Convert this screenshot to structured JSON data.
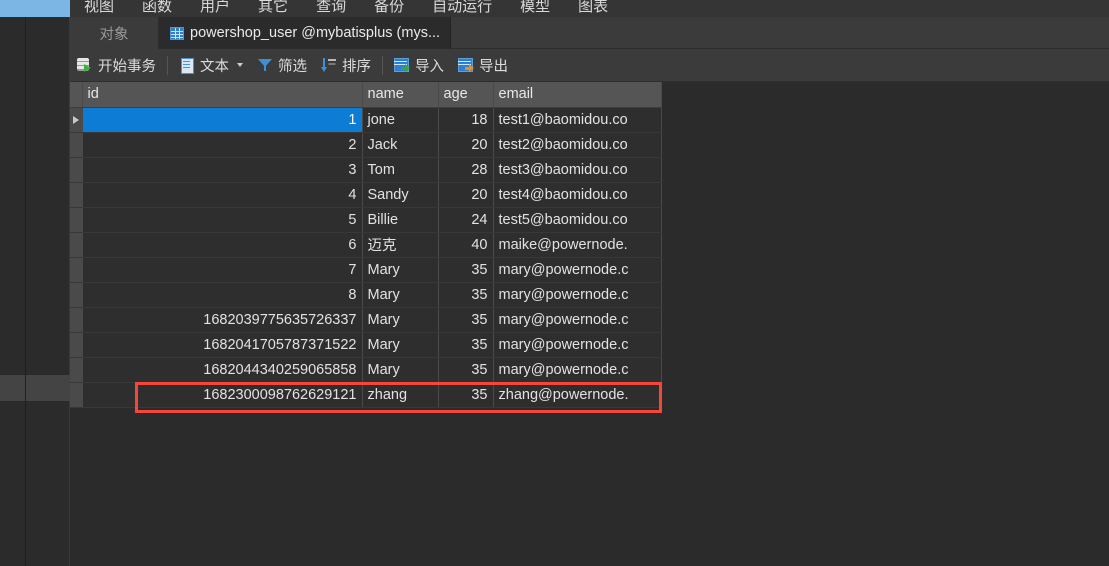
{
  "menubar": {
    "items": [
      {
        "label": "视图"
      },
      {
        "label": "函数"
      },
      {
        "label": "用户"
      },
      {
        "label": "其它"
      },
      {
        "label": "查询"
      },
      {
        "label": "备份"
      },
      {
        "label": "自动运行"
      },
      {
        "label": "模型"
      },
      {
        "label": "图表"
      }
    ],
    "accent_color": "#7bb6e4"
  },
  "tabs": {
    "objects_label": "对象",
    "active": {
      "label": "powershop_user @mybatisplus (mys...",
      "icon": "grid-table-icon"
    }
  },
  "toolbar": {
    "buttons": [
      {
        "label": "开始事务",
        "icon": "transaction-icon"
      },
      {
        "label": "文本",
        "icon": "text-document-icon",
        "has_caret": true
      },
      {
        "label": "筛选",
        "icon": "filter-funnel-icon"
      },
      {
        "label": "排序",
        "icon": "sort-descending-icon"
      },
      {
        "label": "导入",
        "icon": "import-icon"
      },
      {
        "label": "导出",
        "icon": "export-icon"
      }
    ]
  },
  "grid": {
    "columns": [
      "id",
      "name",
      "age",
      "email"
    ],
    "selection_color": "#0c7cd5",
    "highlight_color": "#f5453c",
    "rows": [
      {
        "id": "1",
        "name": "jone",
        "age": "18",
        "email": "test1@baomidou.co",
        "selected": true,
        "marker": true
      },
      {
        "id": "2",
        "name": "Jack",
        "age": "20",
        "email": "test2@baomidou.co"
      },
      {
        "id": "3",
        "name": "Tom",
        "age": "28",
        "email": "test3@baomidou.co"
      },
      {
        "id": "4",
        "name": "Sandy",
        "age": "20",
        "email": "test4@baomidou.co"
      },
      {
        "id": "5",
        "name": "Billie",
        "age": "24",
        "email": "test5@baomidou.co"
      },
      {
        "id": "6",
        "name": "迈克",
        "age": "40",
        "email": "maike@powernode."
      },
      {
        "id": "7",
        "name": "Mary",
        "age": "35",
        "email": "mary@powernode.c"
      },
      {
        "id": "8",
        "name": "Mary",
        "age": "35",
        "email": "mary@powernode.c"
      },
      {
        "id": "1682039775635726337",
        "name": "Mary",
        "age": "35",
        "email": "mary@powernode.c"
      },
      {
        "id": "1682041705787371522",
        "name": "Mary",
        "age": "35",
        "email": "mary@powernode.c"
      },
      {
        "id": "1682044340259065858",
        "name": "Mary",
        "age": "35",
        "email": "mary@powernode.c"
      },
      {
        "id": "1682300098762629121",
        "name": "zhang",
        "age": "35",
        "email": "zhang@powernode.",
        "highlighted": true
      }
    ]
  }
}
